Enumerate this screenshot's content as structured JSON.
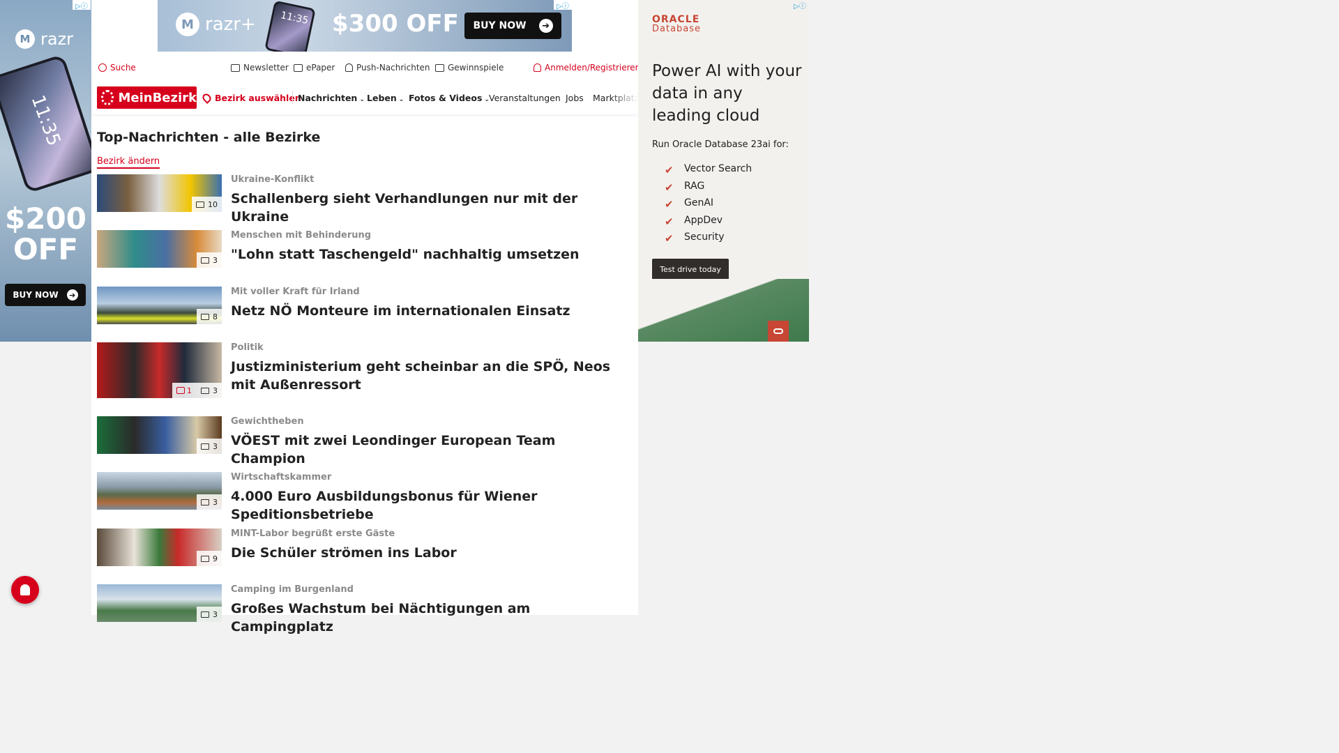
{
  "ad_left": {
    "brand": "razr",
    "phone_time": "11:35",
    "offer": "$200 OFF",
    "cta": "BUY NOW"
  },
  "ad_top": {
    "brand": "razr+",
    "phone_time": "11:35",
    "offer": "$300 OFF",
    "cta": "BUY NOW"
  },
  "utility": {
    "search": "Suche",
    "newsletter": "Newsletter",
    "epaper": "ePaper",
    "push": "Push-Nachrichten",
    "gewinnspiele": "Gewinnspiele",
    "login": "Anmelden/Registrieren"
  },
  "nav": {
    "brand": "MeinBezirk",
    "bezirk": "Bezirk auswählen",
    "items": [
      "Nachrichten",
      "Leben",
      "Fotos & Videos",
      "Veranstaltungen",
      "Jobs",
      "Marktplatz"
    ]
  },
  "content": {
    "heading": "Top-Nachrichten - alle Bezirke",
    "change_link": "Bezirk ändern",
    "articles": [
      {
        "kicker": "Ukraine-Konflikt",
        "title": "Schallenberg sieht Verhandlungen nur mit der Ukraine",
        "images": "10",
        "comments": ""
      },
      {
        "kicker": "Menschen mit Behinderung",
        "title": "\"Lohn statt Taschengeld\" nachhaltig umsetzen",
        "images": "3",
        "comments": ""
      },
      {
        "kicker": "Mit voller Kraft für Irland",
        "title": "Netz NÖ Monteure im internationalen Einsatz",
        "images": "8",
        "comments": ""
      },
      {
        "kicker": "Politik",
        "title": "Justizministerium geht scheinbar an die SPÖ, Neos mit Außenressort",
        "images": "3",
        "comments": "1"
      },
      {
        "kicker": "Gewichtheben",
        "title": "VÖEST mit zwei Leondinger European Team Champion",
        "images": "3",
        "comments": ""
      },
      {
        "kicker": "Wirtschaftskammer",
        "title": "4.000 Euro Ausbildungsbonus für Wiener Speditionsbetriebe",
        "images": "3",
        "comments": ""
      },
      {
        "kicker": "MINT-Labor begrüßt erste Gäste",
        "title": "Die Schüler strömen ins Labor",
        "images": "9",
        "comments": ""
      },
      {
        "kicker": "Camping im Burgenland",
        "title": "Großes Wachstum bei Nächtigungen am Campingplatz",
        "images": "3",
        "comments": ""
      }
    ]
  },
  "ad_right": {
    "brand": "ORACLE",
    "brand_sub": "Database",
    "headline": "Power AI with your data in any leading cloud",
    "sub": "Run Oracle Database 23ai for:",
    "features": [
      "Vector Search",
      "RAG",
      "GenAI",
      "AppDev",
      "Security"
    ],
    "cta": "Test drive today"
  },
  "colors": {
    "brand_red": "#d6001c",
    "oracle_red": "#c74634",
    "kicker_gray": "#8a8a8a"
  }
}
